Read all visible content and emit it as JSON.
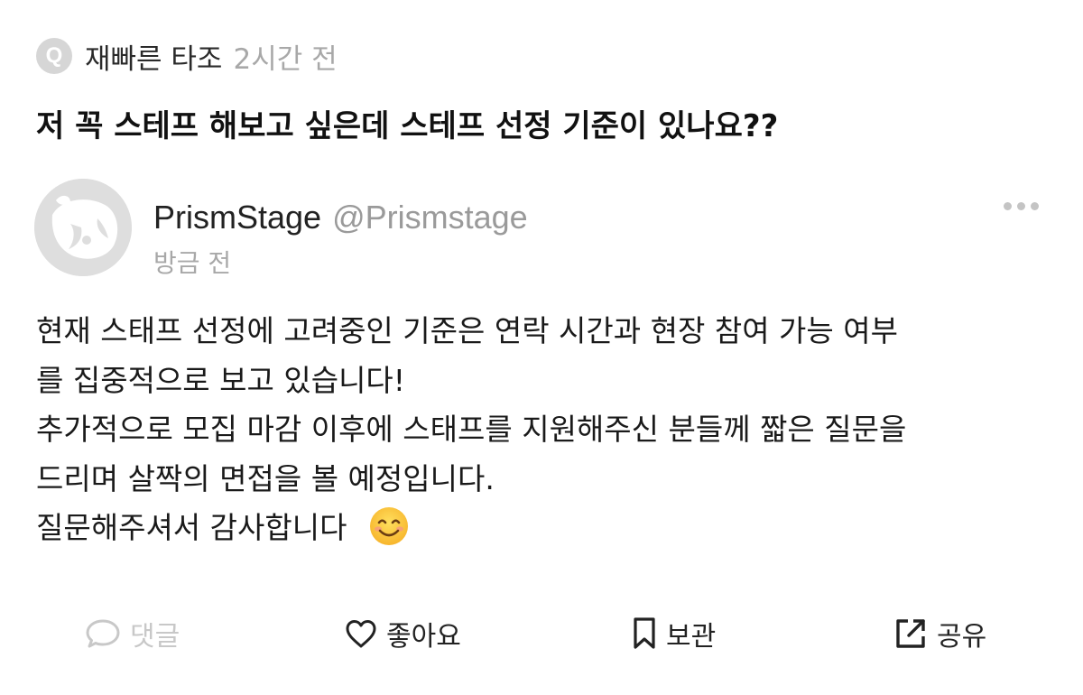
{
  "question": {
    "badge": "Q",
    "asker": "재빠른 타조",
    "time": "2시간 전",
    "text": "저 꼭 스테프 해보고 싶은데 스테프 선정 기준이 있나요??"
  },
  "answer": {
    "author_name": "PrismStage",
    "author_handle": "@Prismstage",
    "time": "방금 전",
    "lines": [
      "현재 스태프 선정에 고려중인 기준은 연락 시간과 현장 참여 가능 여부",
      "를 집중적으로 보고 있습니다!",
      "추가적으로 모집 마감 이후에 스태프를 지원해주신 분들께 짧은 질문을",
      "드리며 살짝의 면접을 볼 예정입니다.",
      "질문해주셔서 감사합니다"
    ],
    "emoji": "smiling-face-icon"
  },
  "actions": {
    "comment_label": "댓글",
    "like_label": "좋아요",
    "save_label": "보관",
    "share_label": "공유"
  },
  "colors": {
    "muted": "#a8a8a8",
    "disabled": "#c8c8c8",
    "text": "#111111",
    "avatar_bg": "#dedede"
  }
}
